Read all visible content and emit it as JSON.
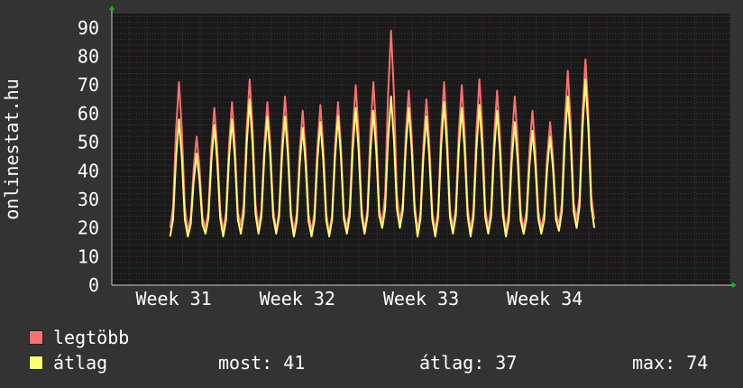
{
  "colors": {
    "background": "#333333",
    "plot_background": "#1a1a1a",
    "grid_minor": "#3a3a3a",
    "grid_major": "#5a2020",
    "axis": "#c8c8c8",
    "text": "#ffffff",
    "arrow": "#00cc00"
  },
  "chart_data": {
    "type": "line",
    "ylabel": "onlinestat.hu",
    "ylim": [
      0,
      95
    ],
    "y_ticks": [
      0,
      10,
      20,
      30,
      40,
      50,
      60,
      70,
      80,
      90
    ],
    "xlim": [
      0,
      35
    ],
    "x_ticks": [
      {
        "label": "Week 31",
        "value": 3.5
      },
      {
        "label": "Week 32",
        "value": 10.5
      },
      {
        "label": "Week 33",
        "value": 17.5
      },
      {
        "label": "Week 34",
        "value": 24.5
      }
    ],
    "x_unit": "days",
    "data_start_day": 3.3,
    "samples_per_day": 6,
    "series": [
      {
        "name": "legtöbb",
        "color": "#ff7070",
        "daily_peaks": [
          71,
          52,
          62,
          64,
          72,
          64,
          66,
          61,
          63,
          64,
          70,
          71,
          89,
          68,
          65,
          71,
          70,
          72,
          68,
          66,
          61,
          57,
          75,
          79
        ],
        "daily_troughs": [
          20,
          19,
          20,
          19,
          21,
          20,
          19,
          19,
          19,
          18,
          20,
          19,
          22,
          22,
          19,
          19,
          20,
          19,
          20,
          19,
          20,
          20,
          21,
          23
        ]
      },
      {
        "name": "átlag",
        "color": "#ffff70",
        "daily_peaks": [
          58,
          46,
          56,
          58,
          65,
          59,
          59,
          55,
          57,
          59,
          62,
          61,
          66,
          62,
          59,
          64,
          62,
          63,
          61,
          57,
          54,
          52,
          66,
          72
        ],
        "daily_troughs": [
          17,
          17,
          18,
          17,
          18,
          18,
          18,
          17,
          17,
          17,
          18,
          18,
          20,
          20,
          17,
          17,
          18,
          17,
          18,
          17,
          18,
          18,
          19,
          20
        ]
      }
    ]
  },
  "stats": {
    "current_label": "most: 41",
    "average_label": "átlag: 37",
    "max_label": "max: 74"
  }
}
